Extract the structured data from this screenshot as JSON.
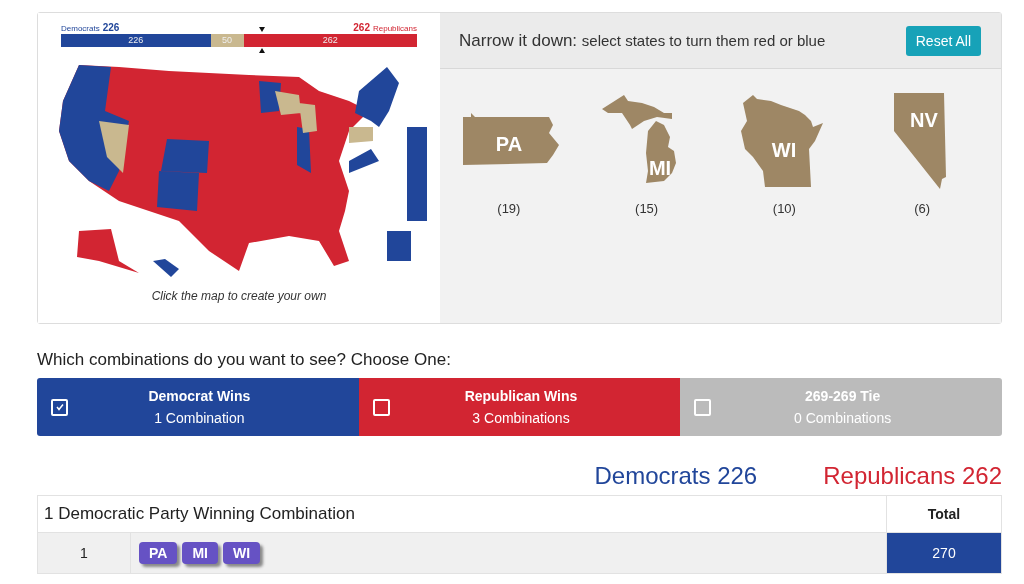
{
  "electoral_bar": {
    "dem_label": "Democrats",
    "dem_total": "226",
    "rep_total": "262",
    "rep_label": "Republicans",
    "segments": [
      {
        "kind": "dem",
        "value": "226"
      },
      {
        "kind": "tossup",
        "value": "50"
      },
      {
        "kind": "rep",
        "value": "262"
      }
    ]
  },
  "map": {
    "kind": "picture",
    "caption": "Click the map to create your own"
  },
  "narrow": {
    "title": "Narrow it down:",
    "subtitle": "select states to turn them red or blue",
    "reset_button": "Reset All",
    "states": [
      {
        "kind": "pa",
        "abbr": "PA",
        "votes": "(19)"
      },
      {
        "kind": "mi",
        "abbr": "MI",
        "votes": "(15)"
      },
      {
        "kind": "wi",
        "abbr": "WI",
        "votes": "(10)"
      },
      {
        "kind": "nv",
        "abbr": "NV",
        "votes": "(6)"
      }
    ]
  },
  "question": "Which combinations do you want to see? Choose One:",
  "choices": [
    {
      "kind": "dem",
      "title": "Democrat Wins",
      "count": "1 Combination",
      "selected": true
    },
    {
      "kind": "rep",
      "title": "Republican Wins",
      "count": "3 Combinations",
      "selected": false
    },
    {
      "kind": "tie",
      "title": "269-269 Tie",
      "count": "0 Combinations",
      "selected": false
    }
  ],
  "totals": [
    {
      "kind": "dem",
      "text": "Democrats 226"
    },
    {
      "kind": "rep",
      "text": "Republicans 262"
    }
  ],
  "table": {
    "heading": "1 Democratic Party Winning Combination",
    "total_heading": "Total",
    "rows": [
      {
        "index": "1",
        "states": [
          "PA",
          "MI",
          "WI"
        ],
        "total": "270"
      }
    ]
  }
}
